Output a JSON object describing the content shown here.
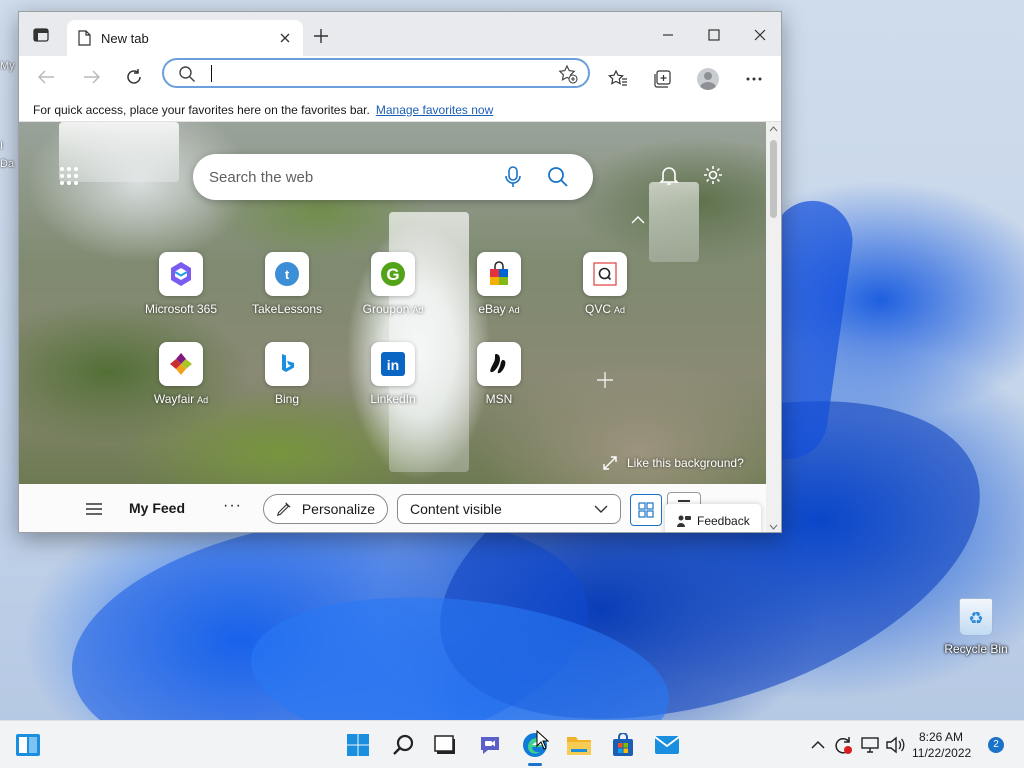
{
  "desktop": {
    "left_labels": [
      "My",
      "I",
      "Da"
    ],
    "recycle_bin_label": "Recycle Bin"
  },
  "browser": {
    "tab_title": "New tab",
    "address_value": "",
    "favorites_bar": {
      "message": "For quick access, place your favorites here on the favorites bar.",
      "link": "Manage favorites now"
    },
    "newtab": {
      "search_placeholder": "Search the web",
      "tiles": [
        {
          "name": "Microsoft 365",
          "ad": "",
          "icon": "microsoft365-icon"
        },
        {
          "name": "TakeLessons",
          "ad": "",
          "icon": "takelessons-icon"
        },
        {
          "name": "Groupon",
          "ad": "Ad",
          "icon": "groupon-icon"
        },
        {
          "name": "eBay",
          "ad": "Ad",
          "icon": "ebay-icon"
        },
        {
          "name": "QVC",
          "ad": "Ad",
          "icon": "qvc-icon"
        },
        {
          "name": "Wayfair",
          "ad": "Ad",
          "icon": "wayfair-icon"
        },
        {
          "name": "Bing",
          "ad": "",
          "icon": "bing-icon"
        },
        {
          "name": "LinkedIn",
          "ad": "",
          "icon": "linkedin-icon"
        },
        {
          "name": "MSN",
          "ad": "",
          "icon": "msn-icon"
        }
      ],
      "like_background": "Like this background?",
      "feed": {
        "title": "My Feed",
        "more": "···",
        "personalize": "Personalize",
        "content_select": "Content visible",
        "feedback": "Feedback"
      }
    }
  },
  "taskbar": {
    "time": "8:26 AM",
    "date": "11/22/2022",
    "notification_count": "2"
  },
  "colors": {
    "accent": "#1a73c8",
    "favorites_link": "#1b5fb5",
    "address_border": "#6b9edb"
  }
}
